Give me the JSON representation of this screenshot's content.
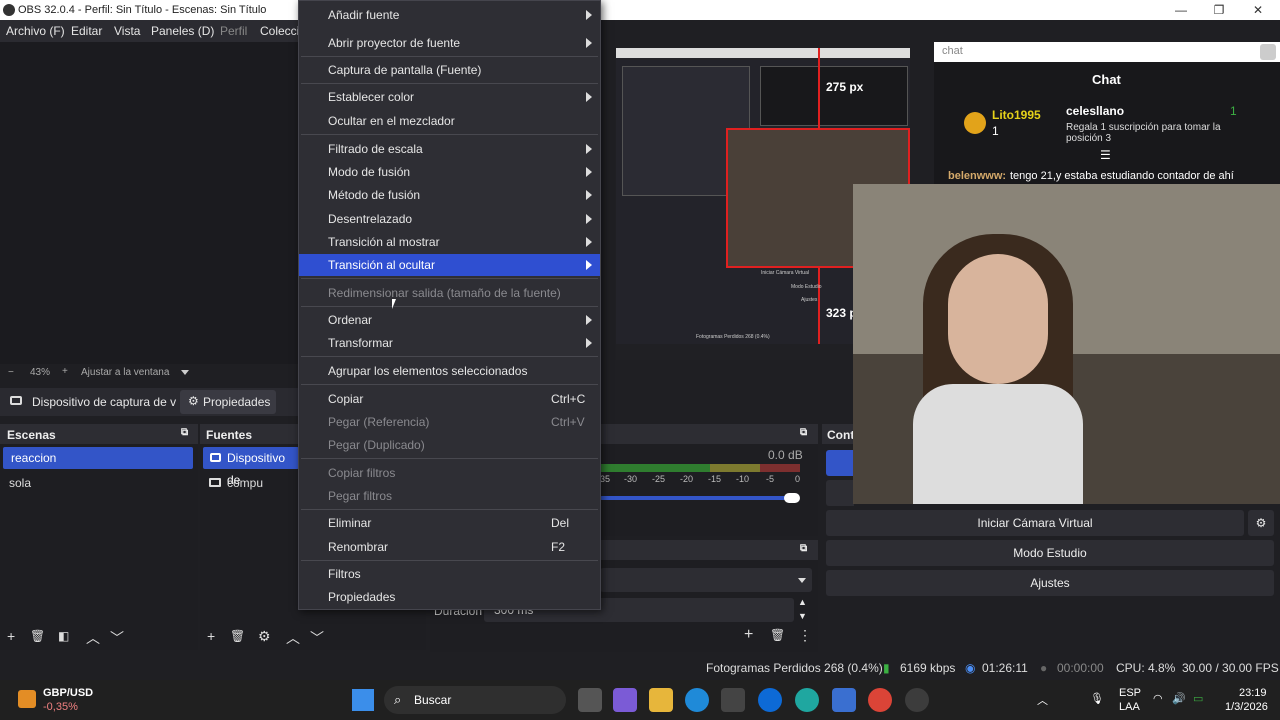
{
  "window": {
    "title": "OBS 32.0.4 - Perfil: Sin Título - Escenas: Sin Título",
    "minimize": "—",
    "maximize": "❐",
    "close": "✕"
  },
  "menubar": [
    "Archivo (F)",
    "Editar",
    "Vista",
    "Paneles (D)",
    "Perfil",
    "Colecci"
  ],
  "zoom": {
    "minus": "−",
    "value": "43%",
    "plus": "+",
    "fit_label": "Ajustar a la ventana"
  },
  "source_toolbar": {
    "device": "Dispositivo de captura de v",
    "properties": "Propiedades"
  },
  "scenes": {
    "header": "Escenas",
    "items": [
      "reaccion",
      "sola"
    ],
    "selected_index": 0
  },
  "sources": {
    "header": "Fuentes",
    "items": [
      "Dispositivo de",
      "compu"
    ],
    "selected_index": 0
  },
  "mixer": {
    "db": "0.0 dB",
    "ticks": [
      "35",
      "-30",
      "-25",
      "-20",
      "-15",
      "-10",
      "-5",
      "0"
    ]
  },
  "transitions": {
    "duration_label": "Duración",
    "duration_value": "300 ms"
  },
  "controls": {
    "header": "Cont",
    "virtual_cam": "Iniciar Cámara Virtual",
    "studio": "Modo Estudio",
    "settings": "Ajustes"
  },
  "context_menu": {
    "items": [
      {
        "label": "Añadir fuente",
        "submenu": true
      },
      {
        "label": "Abrir proyector de fuente",
        "submenu": true
      },
      {
        "label": "Captura de pantalla (Fuente)"
      },
      {
        "label": "Establecer color",
        "submenu": true
      },
      {
        "label": "Ocultar en el mezclador"
      },
      {
        "label": "Filtrado de escala",
        "submenu": true
      },
      {
        "label": "Modo de fusión",
        "submenu": true
      },
      {
        "label": "Método de fusión",
        "submenu": true
      },
      {
        "label": "Desentrelazado",
        "submenu": true
      },
      {
        "label": "Transición al mostrar",
        "submenu": true
      },
      {
        "label": "Transición al ocultar",
        "submenu": true,
        "highlighted": true
      },
      {
        "label": "Redimensionar salida (tamaño de la fuente)",
        "disabled": true
      },
      {
        "label": "Ordenar",
        "submenu": true
      },
      {
        "label": "Transformar",
        "submenu": true
      },
      {
        "label": "Agrupar los elementos seleccionados"
      },
      {
        "label": "Copiar",
        "shortcut": "Ctrl+C"
      },
      {
        "label": "Pegar (Referencia)",
        "shortcut": "Ctrl+V",
        "disabled": true
      },
      {
        "label": "Pegar (Duplicado)",
        "disabled": true
      },
      {
        "label": "Copiar filtros",
        "disabled": true
      },
      {
        "label": "Pegar filtros",
        "disabled": true
      },
      {
        "label": "Eliminar",
        "shortcut": "Del"
      },
      {
        "label": "Renombrar",
        "shortcut": "F2"
      },
      {
        "label": "Filtros"
      },
      {
        "label": "Propiedades"
      }
    ]
  },
  "preview": {
    "px_top": "275 px",
    "px_bottom": "323 p",
    "chat_title": "Chat",
    "chat_users": [
      "Lito1995",
      "celesllano"
    ],
    "chat_badge_counts": [
      "1",
      "1"
    ],
    "chat_gift": "Regala 1 suscripción para tomar la posición 3",
    "chat_msg_user": "belenwww:",
    "chat_msg_text": "tengo 21,y estaba estudiando contador de ahí",
    "chat_search": "chat",
    "lost_frames_small": "Fotogramas Perdidos 268 (0.4%)",
    "mini_menu": [
      "Iniciar Cámara Virtual",
      "Modo Estudio",
      "Ajustes"
    ]
  },
  "status": {
    "lost_frames": "Fotogramas Perdidos 268 (0.4%)",
    "kbps": "6169 kbps",
    "stream_time": "01:26:11",
    "rec_time": "00:00:00",
    "cpu": "CPU: 4.8%",
    "fps": "30.00 / 30.00 FPS"
  },
  "taskbar": {
    "ticker": "GBP/USD",
    "change": "-0,35%",
    "search": "Buscar",
    "lang1": "ESP",
    "lang2": "LAA",
    "time": "23:19",
    "date": "1/3/2026"
  },
  "colors": {
    "accent": "#2f4fd1",
    "selection": "#3355c8",
    "status_green": "#3cb043"
  }
}
